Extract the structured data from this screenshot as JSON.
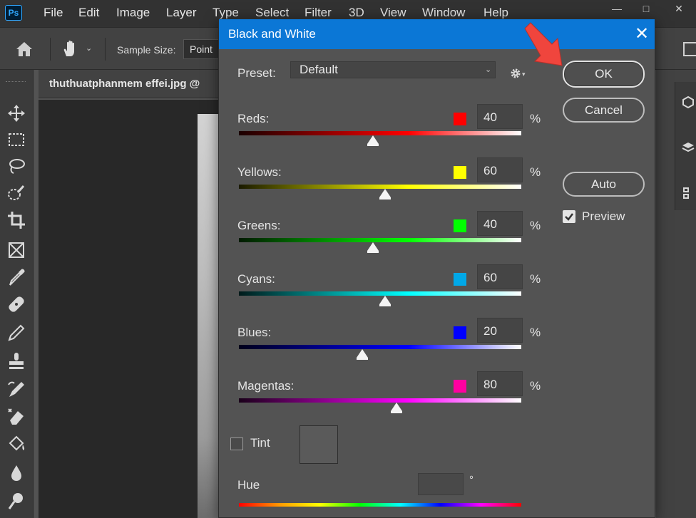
{
  "app": {
    "logo": "Ps",
    "menu": [
      "File",
      "Edit",
      "Image",
      "Layer",
      "Type",
      "Select",
      "Filter",
      "3D",
      "View",
      "Window",
      "Help"
    ]
  },
  "options_bar": {
    "sample_size_label": "Sample Size:",
    "sample_size_value": "Point"
  },
  "document": {
    "tab_title": "thuthuatphanmem effei.jpg @"
  },
  "dialog": {
    "title": "Black and White",
    "preset_label": "Preset:",
    "preset_value": "Default",
    "sliders": [
      {
        "label": "Reds:",
        "value": "40",
        "swatch": "#ff0000",
        "gradient": [
          "#1a0000",
          "#ff0000",
          "#ffffff"
        ],
        "fraction": 0.475
      },
      {
        "label": "Yellows:",
        "value": "60",
        "swatch": "#ffff00",
        "gradient": [
          "#1a1a00",
          "#ffff00",
          "#ffffff"
        ],
        "fraction": 0.518
      },
      {
        "label": "Greens:",
        "value": "40",
        "swatch": "#00ff00",
        "gradient": [
          "#001a00",
          "#00ff00",
          "#ffffff"
        ],
        "fraction": 0.475
      },
      {
        "label": "Cyans:",
        "value": "60",
        "swatch": "#00a8e8",
        "gradient": [
          "#001a1a",
          "#00ffff",
          "#ffffff"
        ],
        "fraction": 0.518
      },
      {
        "label": "Blues:",
        "value": "20",
        "swatch": "#0000ff",
        "gradient": [
          "#00001a",
          "#0000ff",
          "#ffffff"
        ],
        "fraction": 0.436
      },
      {
        "label": "Magentas:",
        "value": "80",
        "swatch": "#ff00a0",
        "gradient": [
          "#1a001a",
          "#ff00ff",
          "#ffffff"
        ],
        "fraction": 0.558
      }
    ],
    "percent_sign": "%",
    "tint_label": "Tint",
    "hue_label": "Hue",
    "hue_value": "",
    "degree_sign": "°",
    "ok_label": "OK",
    "cancel_label": "Cancel",
    "auto_label": "Auto",
    "preview_label": "Preview",
    "preview_checked": true,
    "tint_checked": false
  },
  "colors": {
    "titlebar": "#0b77d6",
    "annotation_arrow": "#f0453d"
  }
}
